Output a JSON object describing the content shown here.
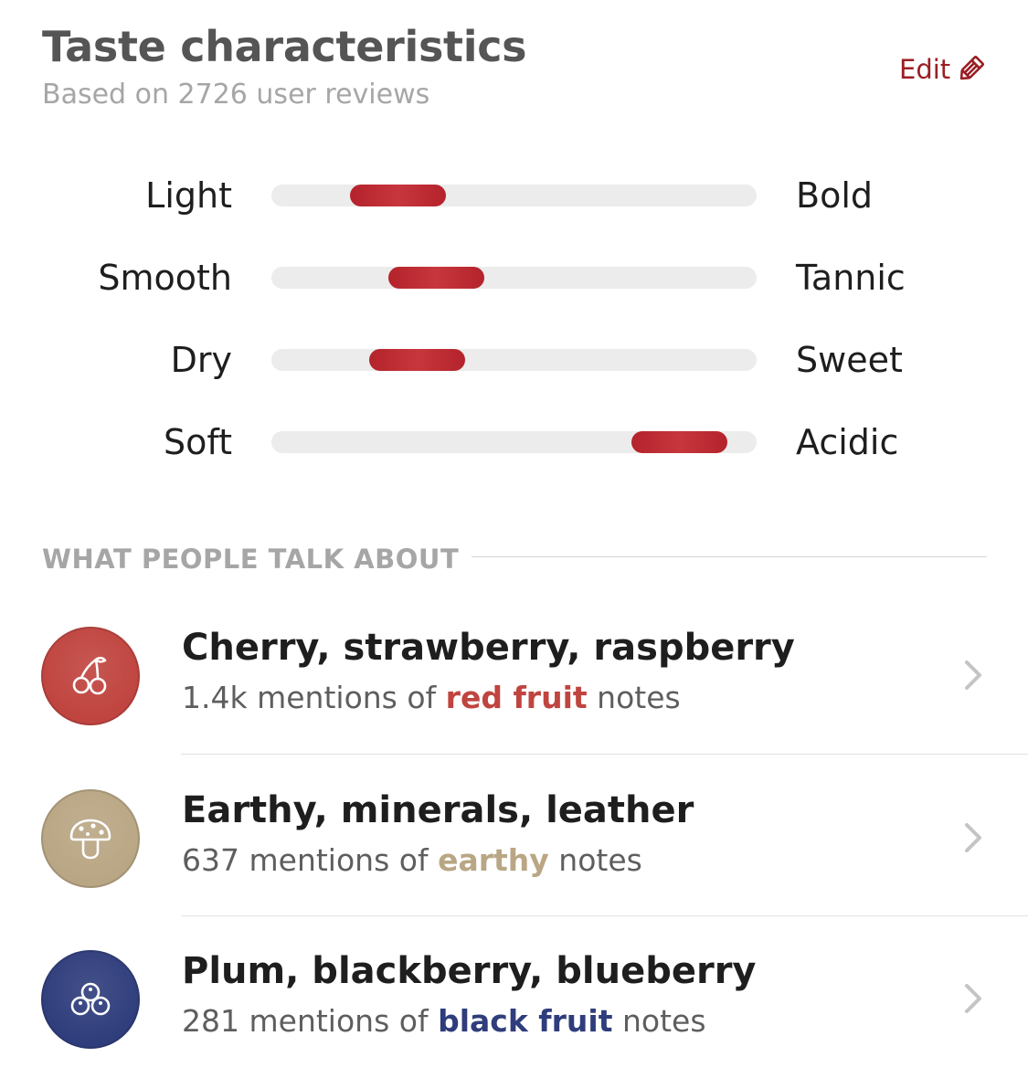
{
  "header": {
    "title": "Taste characteristics",
    "subtitle": "Based on 2726 user reviews",
    "edit_label": "Edit"
  },
  "colors": {
    "accent": "#9a1e23",
    "marker": "#b4232b",
    "track": "#ececec",
    "red_fruit": "#c0443f",
    "earthy": "#b9a684",
    "black_fruit": "#2f3d7c"
  },
  "scales": [
    {
      "left": "Light",
      "right": "Bold",
      "level": 0.26
    },
    {
      "left": "Smooth",
      "right": "Tannic",
      "level": 0.34
    },
    {
      "left": "Dry",
      "right": "Sweet",
      "level": 0.3
    },
    {
      "left": "Soft",
      "right": "Acidic",
      "level": 0.84
    }
  ],
  "section": {
    "title": "WHAT PEOPLE TALK ABOUT"
  },
  "notes": [
    {
      "title": "Cherry, strawberry, raspberry",
      "count": "1.4k",
      "prefix": "mentions of",
      "category": "red fruit",
      "suffix": "notes",
      "icon": "cherry-icon",
      "color": "#c0443f"
    },
    {
      "title": "Earthy, minerals, leather",
      "count": "637",
      "prefix": "mentions of",
      "category": "earthy",
      "suffix": "notes",
      "icon": "mushroom-icon",
      "color": "#b9a684"
    },
    {
      "title": "Plum, blackberry, blueberry",
      "count": "281",
      "prefix": "mentions of",
      "category": "black fruit",
      "suffix": "notes",
      "icon": "berries-icon",
      "color": "#2f3d7c"
    }
  ]
}
